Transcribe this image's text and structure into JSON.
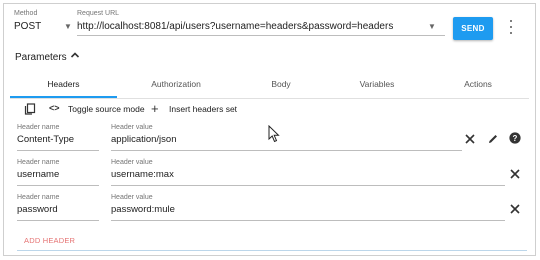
{
  "request": {
    "method_label": "Method",
    "method_value": "POST",
    "url_label": "Request URL",
    "url_value": "http://localhost:8081/api/users?username=headers&password=headers",
    "send_label": "SEND"
  },
  "parameters": {
    "title": "Parameters"
  },
  "tabs": [
    {
      "label": "Headers",
      "active": true
    },
    {
      "label": "Authorization"
    },
    {
      "label": "Body"
    },
    {
      "label": "Variables"
    },
    {
      "label": "Actions"
    }
  ],
  "toolbar": {
    "toggle_source_label": "Toggle source mode",
    "insert_headers_label": "Insert headers set"
  },
  "headers": [
    {
      "name_label": "Header name",
      "value_label": "Header value",
      "name": "Content-Type",
      "value": "application/json"
    },
    {
      "name_label": "Header name",
      "value_label": "Header value",
      "name": "username",
      "value": "username:max"
    },
    {
      "name_label": "Header name",
      "value_label": "Header value",
      "name": "password",
      "value": "password:mule"
    }
  ],
  "add_header_label": "ADD HEADER",
  "colors": {
    "accent": "#1e9bf0",
    "add_header": "#e57373"
  }
}
